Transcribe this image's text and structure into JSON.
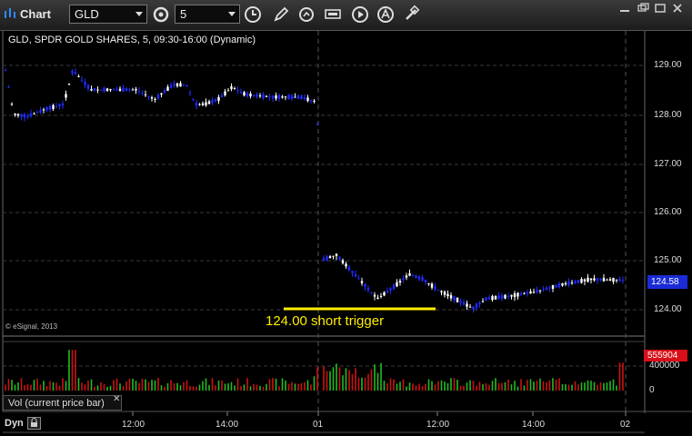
{
  "toolbar": {
    "app_title": "Chart",
    "symbol_value": "GLD",
    "interval_value": "5"
  },
  "chart": {
    "header": "GLD, SPDR GOLD SHARES, 5, 09:30-16:00 (Dynamic)",
    "copyright": "© eSignal, 2013",
    "annotation": "124.00 short trigger",
    "price_axis": [
      "129.00",
      "128.00",
      "127.00",
      "126.00",
      "125.00",
      "124.00"
    ],
    "time_axis": [
      "12:00",
      "14:00",
      "01",
      "12:00",
      "14:00",
      "02"
    ],
    "last_price": "124.58",
    "volume_axis": [
      "400000",
      "0"
    ],
    "last_volume": "555904",
    "volume_study": "Vol (current price bar)",
    "dyn_label": "Dyn"
  },
  "colors": {
    "up_bar": "#ffffff",
    "down_bar": "#1f2bff",
    "annotation": "#ffee00",
    "vol_up": "#22bb22",
    "vol_down": "#cc1111"
  },
  "chart_data": {
    "type": "candlestick",
    "symbol": "GLD",
    "ylim": [
      123.7,
      129.4
    ],
    "day1_close_approx": 128.2,
    "day2_open_approx": 125.1,
    "day2_low_approx": 123.9,
    "last": 124.58,
    "trigger_level": 124.0
  }
}
